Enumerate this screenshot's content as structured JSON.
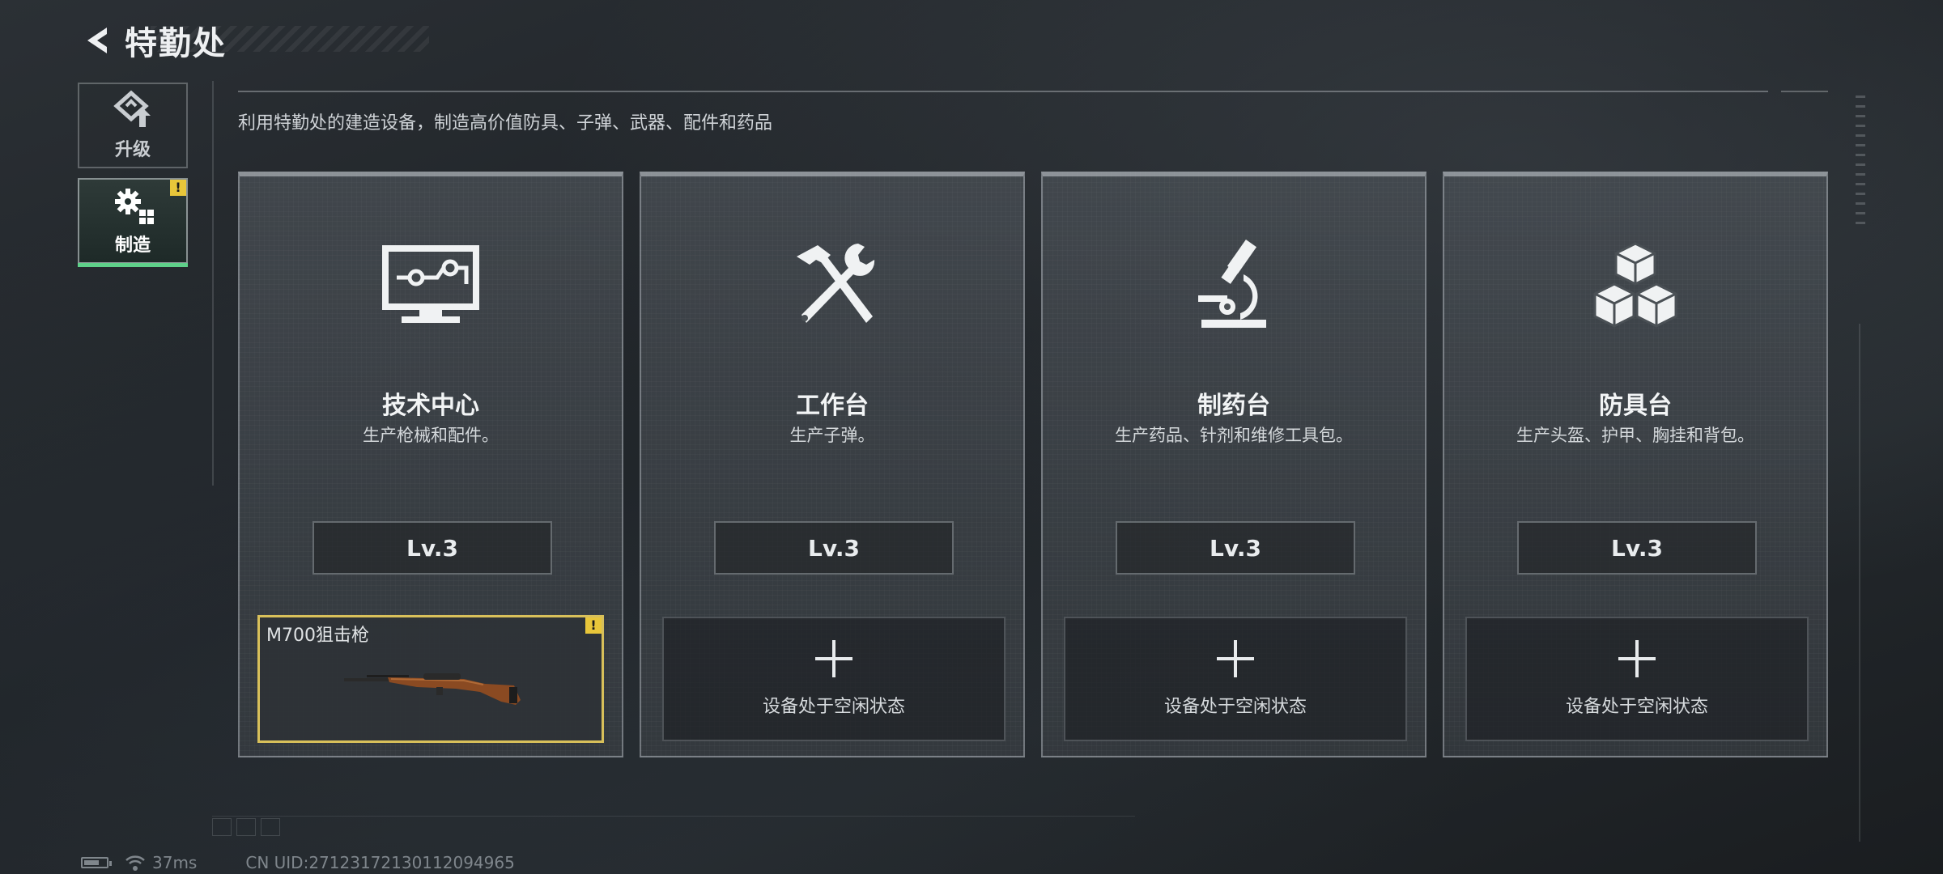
{
  "header": {
    "title": "特勤处"
  },
  "nav": {
    "items": [
      {
        "label": "升级",
        "active": false,
        "icon": "upgrade-icon"
      },
      {
        "label": "制造",
        "active": true,
        "icon": "gears-icon",
        "badge": "!"
      }
    ]
  },
  "subtitle": "利用特勤处的建造设备，制造高价值防具、子弹、武器、配件和药品",
  "stations": [
    {
      "title": "技术中心",
      "desc": "生产枪械和配件。",
      "level": "Lv.3",
      "icon": "computer-icon",
      "slot": {
        "state": "crafting",
        "item_name": "M700狙击枪",
        "badge": "!",
        "icon": "rifle-icon"
      }
    },
    {
      "title": "工作台",
      "desc": "生产子弹。",
      "level": "Lv.3",
      "icon": "hammer-wrench-icon",
      "slot": {
        "state": "idle",
        "text": "设备处于空闲状态"
      }
    },
    {
      "title": "制药台",
      "desc": "生产药品、针剂和维修工具包。",
      "level": "Lv.3",
      "icon": "microscope-icon",
      "slot": {
        "state": "idle",
        "text": "设备处于空闲状态"
      }
    },
    {
      "title": "防具台",
      "desc": "生产头盔、护甲、胸挂和背包。",
      "level": "Lv.3",
      "icon": "cubes-icon",
      "slot": {
        "state": "idle",
        "text": "设备处于空闲状态"
      }
    }
  ],
  "status": {
    "ping": "37ms",
    "uid": "CN UID:27123172130112094965"
  },
  "colors": {
    "accent_green": "#5fd08a",
    "warning_yellow": "#e8c63a",
    "slot_border_gold": "#d8c05a"
  }
}
